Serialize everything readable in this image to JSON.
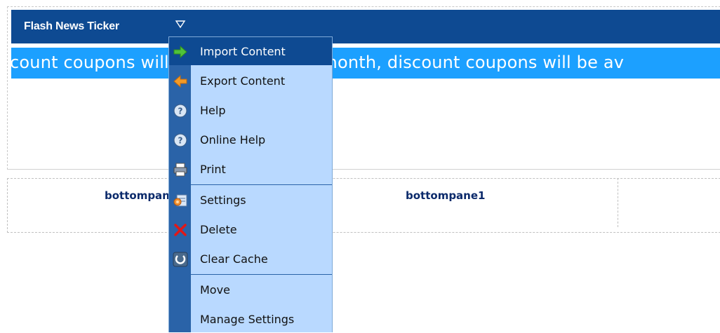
{
  "module": {
    "title": "Flash News Ticker",
    "ticker_text": "count coupons will be available this month, discount coupons will be av"
  },
  "bottom_panes": [
    {
      "label": "bottompane1"
    },
    {
      "label": "bottompane1"
    }
  ],
  "context_menu": {
    "items": [
      {
        "label": "Import Content",
        "icon": "arrow-right-icon",
        "hover": true
      },
      {
        "label": "Export Content",
        "icon": "arrow-left-icon"
      },
      {
        "label": "Help",
        "icon": "help-icon"
      },
      {
        "label": "Online Help",
        "icon": "help-icon"
      },
      {
        "label": "Print",
        "icon": "printer-icon"
      },
      {
        "label": "Settings",
        "icon": "settings-icon"
      },
      {
        "label": "Delete",
        "icon": "delete-icon"
      },
      {
        "label": "Clear Cache",
        "icon": "refresh-icon"
      },
      {
        "label": "Move",
        "icon": ""
      },
      {
        "label": "Manage Settings",
        "icon": ""
      }
    ]
  },
  "colors": {
    "header_bg": "#0e4a92",
    "ticker_bg": "#1ca0ff",
    "menu_bg": "#b9d9ff",
    "menu_gutter": "#2a63a8"
  }
}
